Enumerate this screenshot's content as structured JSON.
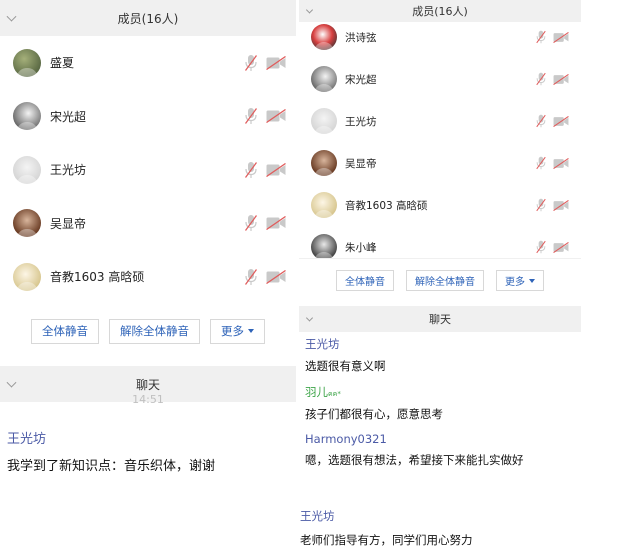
{
  "left": {
    "members_header": "成员(16人)",
    "members": [
      {
        "name": "盛夏",
        "avatar": "photo-avatar"
      },
      {
        "name": "宋光超",
        "avatar": "photo-avatar"
      },
      {
        "name": "王光坊",
        "avatar": "default-avatar"
      },
      {
        "name": "吴显帝",
        "avatar": "photo-avatar"
      },
      {
        "name": "音教1603 高晗硕",
        "avatar": "photo-avatar"
      }
    ],
    "buttons": {
      "mute_all": "全体静音",
      "unmute_all": "解除全体静音",
      "more": "更多"
    },
    "chat_header": "聊天",
    "chat_time": "14:51",
    "messages": [
      {
        "sender": "王光坊",
        "text": "我学到了新知识点：音乐织体，谢谢"
      }
    ]
  },
  "right": {
    "members_header": "成员(16人)",
    "members": [
      {
        "name": "洪诗弦",
        "avatar": "photo-avatar"
      },
      {
        "name": "宋光超",
        "avatar": "photo-avatar"
      },
      {
        "name": "王光坊",
        "avatar": "default-avatar"
      },
      {
        "name": "吴显帝",
        "avatar": "photo-avatar"
      },
      {
        "name": "音教1603 高晗硕",
        "avatar": "photo-avatar"
      },
      {
        "name": "朱小峰",
        "avatar": "photo-avatar"
      }
    ],
    "buttons": {
      "mute_all": "全体静音",
      "unmute_all": "解除全体静音",
      "more": "更多"
    },
    "chat_header": "聊天",
    "messages": [
      {
        "sender": "王光坊",
        "text": "选题很有意义啊"
      },
      {
        "sender": "羽儿",
        "sender_tag": "ฅฅ*",
        "text": "孩子们都很有心，愿意思考"
      },
      {
        "sender": "Harmony0321",
        "text": "嗯，选题很有想法，希望接下来能扎实做好"
      }
    ],
    "extra_message": {
      "sender": "王光坊",
      "text": "老师们指导有方，同学们用心努力"
    }
  },
  "colors": {
    "header_bg": "#f0f0f0",
    "button_text": "#2e63b8",
    "sender_name": "#4b5aa6",
    "sender_name_alt": "#3fa54a",
    "muted_icon": "#e05c5c"
  }
}
